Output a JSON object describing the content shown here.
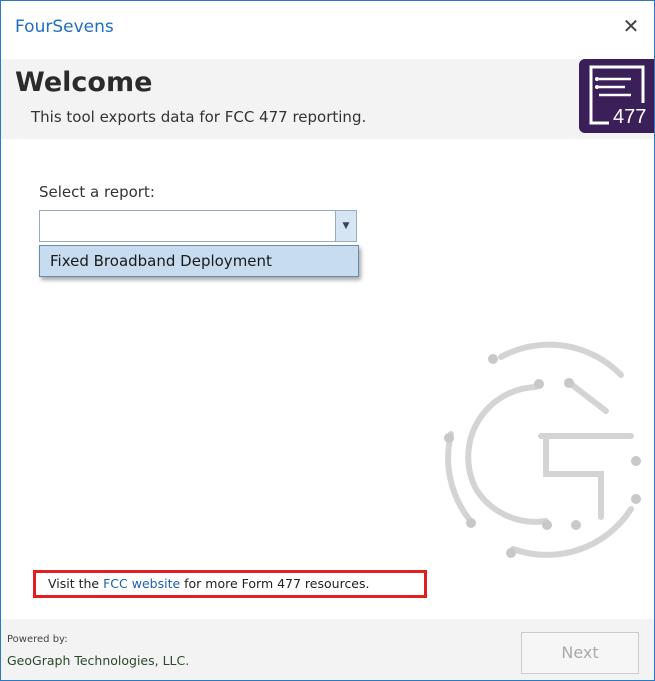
{
  "window": {
    "title": "FourSevens",
    "close_glyph": "✕"
  },
  "header": {
    "heading": "Welcome",
    "subtitle": "This tool exports data for FCC 477 reporting.",
    "logo_text": "477",
    "logo_icon": "list-doc-icon",
    "logo_color": "#3a1f58"
  },
  "form": {
    "select_label": "Select a report:",
    "selected_value": "",
    "options": [
      "Fixed Broadband Deployment"
    ]
  },
  "note": {
    "prefix": "Visit the ",
    "link_text": "FCC website",
    "suffix": " for more Form 477 resources."
  },
  "footer": {
    "powered_by": "Powered by:",
    "company": "GeoGraph Technologies, LLC.",
    "next_label": "Next"
  },
  "colors": {
    "accent": "#1e6fc2",
    "highlight_border": "#e02020",
    "dropdown_selected": "#c8dcef"
  }
}
